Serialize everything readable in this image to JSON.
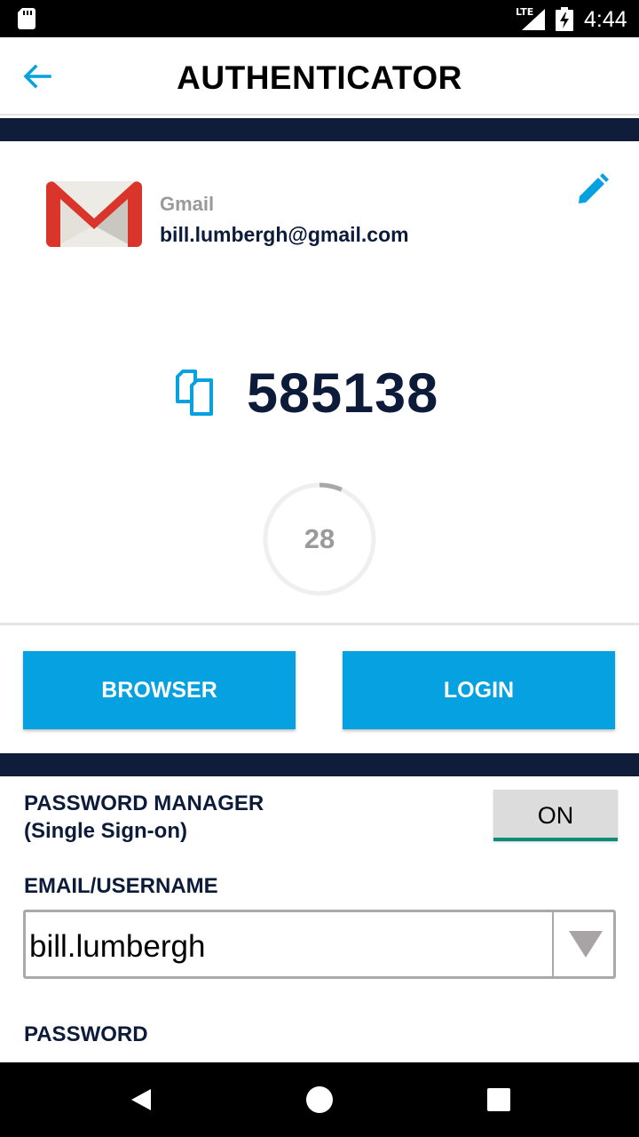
{
  "status_bar": {
    "network": "LTE",
    "time": "4:44",
    "icons": [
      "sd-card-icon",
      "signal-icon",
      "battery-charging-icon"
    ]
  },
  "header": {
    "title": "AUTHENTICATOR",
    "back_icon": "arrow-left-icon"
  },
  "account": {
    "service": "Gmail",
    "email": "bill.lumbergh@gmail.com",
    "logo": "gmail-logo",
    "edit_icon": "pencil-icon"
  },
  "otp": {
    "code": "585138",
    "copy_icon": "copy-icon",
    "seconds_remaining": "28",
    "period_seconds": 30
  },
  "actions": {
    "browser_label": "BROWSER",
    "login_label": "LOGIN"
  },
  "password_manager": {
    "title_line1": "PASSWORD MANAGER",
    "title_line2": "(Single Sign-on)",
    "toggle_label": "ON"
  },
  "credentials": {
    "username_label": "EMAIL/USERNAME",
    "username_value": "bill.lumbergh",
    "password_label": "PASSWORD"
  },
  "colors": {
    "accent": "#05a1e0",
    "navy": "#0f1c3a",
    "toggle_underline": "#0f8c77"
  },
  "nav_bar": {
    "icons": [
      "nav-back-icon",
      "nav-home-icon",
      "nav-recents-icon"
    ]
  }
}
